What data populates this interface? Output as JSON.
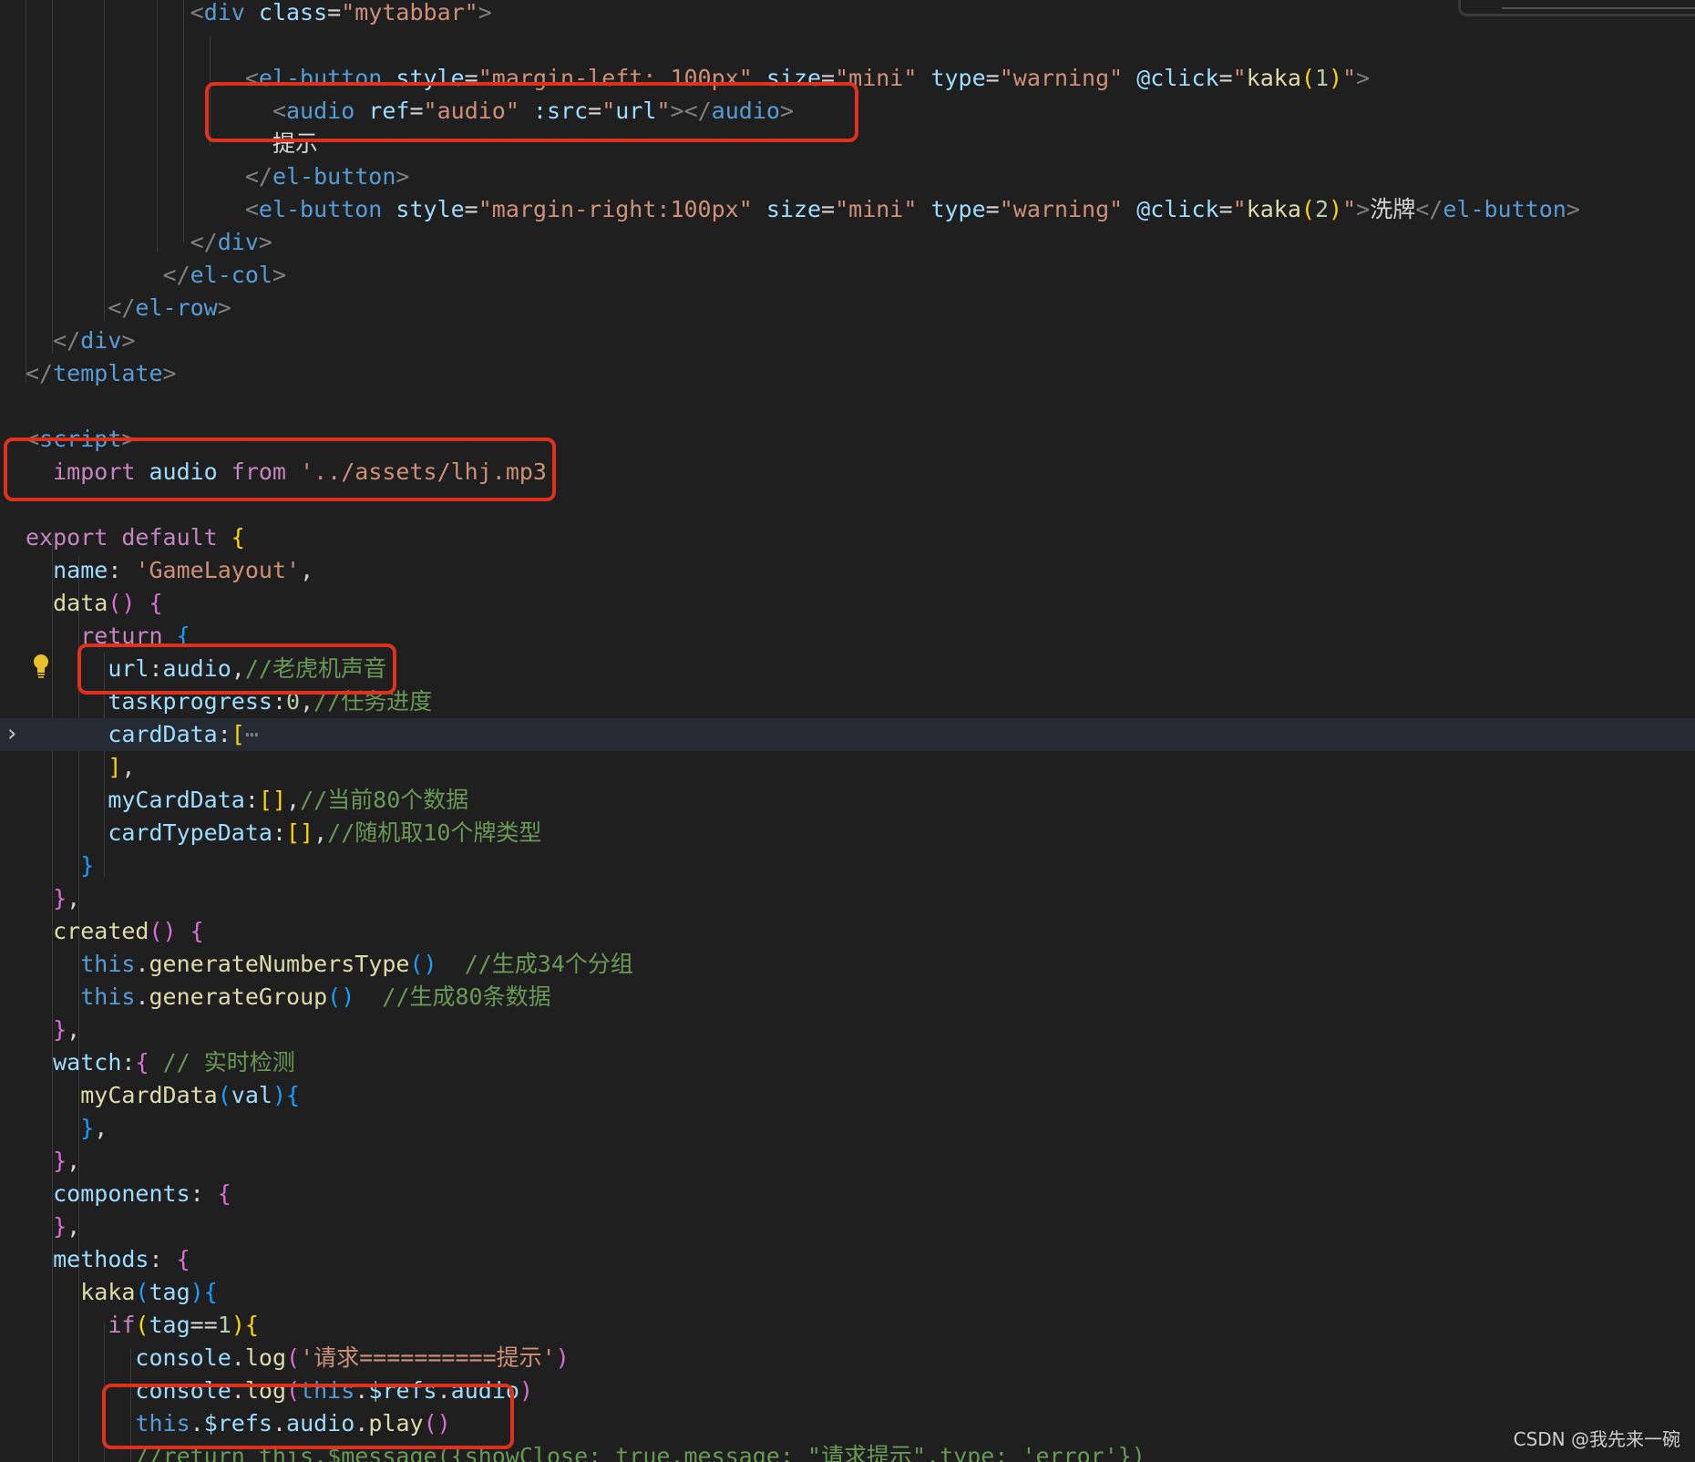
{
  "colors": {
    "background": "#1f1f1f",
    "tag": "#569cd6",
    "bracket": "#808080",
    "attr": "#9cdcfe",
    "string": "#ce9178",
    "keyword": "#c586c0",
    "thisKw": "#569cd6",
    "function": "#dcdcaa",
    "comment": "#6a9955",
    "number": "#b5cea8",
    "plain": "#d4d4d4",
    "brace1": "#ffd700",
    "brace2": "#da70d6",
    "brace3": "#179fff",
    "annotation": "#e0311d"
  },
  "icons": [
    "chevron-right-icon",
    "lightbulb-icon"
  ],
  "watermark": "CSDN @我先来一碗",
  "lines": [
    {
      "id": "l1",
      "tokens": [
        [
          "            ",
          "plain"
        ],
        [
          "<",
          "bracket"
        ],
        [
          "div",
          "tag"
        ],
        [
          " class",
          "attr"
        ],
        [
          "=",
          "plain"
        ],
        [
          "\"mytabbar\"",
          "string"
        ],
        [
          ">",
          "bracket"
        ]
      ]
    },
    {
      "id": "l2",
      "tokens": []
    },
    {
      "id": "l3",
      "tokens": [
        [
          "                ",
          "plain"
        ],
        [
          "<",
          "bracket"
        ],
        [
          "el-button",
          "tag"
        ],
        [
          " style",
          "attr"
        ],
        [
          "=",
          "plain"
        ],
        [
          "\"margin-left: 100px\"",
          "string"
        ],
        [
          " size",
          "attr"
        ],
        [
          "=",
          "plain"
        ],
        [
          "\"mini\"",
          "string"
        ],
        [
          " type",
          "attr"
        ],
        [
          "=",
          "plain"
        ],
        [
          "\"warning\"",
          "string"
        ],
        [
          " @click",
          "attr"
        ],
        [
          "=",
          "plain"
        ],
        [
          "\"",
          "string"
        ],
        [
          "kaka",
          "function"
        ],
        [
          "(",
          "brace1"
        ],
        [
          "1",
          "number"
        ],
        [
          ")",
          "brace1"
        ],
        [
          "\"",
          "string"
        ],
        [
          ">",
          "bracket"
        ]
      ]
    },
    {
      "id": "l4",
      "tokens": [
        [
          "                  ",
          "plain"
        ],
        [
          "<",
          "bracket"
        ],
        [
          "audio",
          "tag"
        ],
        [
          " ref",
          "attr"
        ],
        [
          "=",
          "plain"
        ],
        [
          "\"audio\"",
          "string"
        ],
        [
          " :src",
          "attr"
        ],
        [
          "=",
          "plain"
        ],
        [
          "\"",
          "string"
        ],
        [
          "url",
          "attr"
        ],
        [
          "\"",
          "string"
        ],
        [
          "></",
          "bracket"
        ],
        [
          "audio",
          "tag"
        ],
        [
          ">",
          "bracket"
        ]
      ]
    },
    {
      "id": "l5",
      "tokens": [
        [
          "                  ",
          "plain"
        ],
        [
          "提示",
          "plain"
        ]
      ]
    },
    {
      "id": "l6",
      "tokens": [
        [
          "                ",
          "plain"
        ],
        [
          "</",
          "bracket"
        ],
        [
          "el-button",
          "tag"
        ],
        [
          ">",
          "bracket"
        ]
      ]
    },
    {
      "id": "l7",
      "tokens": [
        [
          "                ",
          "plain"
        ],
        [
          "<",
          "bracket"
        ],
        [
          "el-button",
          "tag"
        ],
        [
          " style",
          "attr"
        ],
        [
          "=",
          "plain"
        ],
        [
          "\"margin-right:100px\"",
          "string"
        ],
        [
          " size",
          "attr"
        ],
        [
          "=",
          "plain"
        ],
        [
          "\"mini\"",
          "string"
        ],
        [
          " type",
          "attr"
        ],
        [
          "=",
          "plain"
        ],
        [
          "\"warning\"",
          "string"
        ],
        [
          " @click",
          "attr"
        ],
        [
          "=",
          "plain"
        ],
        [
          "\"",
          "string"
        ],
        [
          "kaka",
          "function"
        ],
        [
          "(",
          "brace1"
        ],
        [
          "2",
          "number"
        ],
        [
          ")",
          "brace1"
        ],
        [
          "\"",
          "string"
        ],
        [
          ">",
          "bracket"
        ],
        [
          "洗牌",
          "plain"
        ],
        [
          "</",
          "bracket"
        ],
        [
          "el-button",
          "tag"
        ],
        [
          ">",
          "bracket"
        ]
      ]
    },
    {
      "id": "l8",
      "tokens": [
        [
          "            ",
          "plain"
        ],
        [
          "</",
          "bracket"
        ],
        [
          "div",
          "tag"
        ],
        [
          ">",
          "bracket"
        ]
      ]
    },
    {
      "id": "l9",
      "tokens": [
        [
          "          ",
          "plain"
        ],
        [
          "</",
          "bracket"
        ],
        [
          "el-col",
          "tag"
        ],
        [
          ">",
          "bracket"
        ]
      ]
    },
    {
      "id": "l10",
      "tokens": [
        [
          "      ",
          "plain"
        ],
        [
          "</",
          "bracket"
        ],
        [
          "el-row",
          "tag"
        ],
        [
          ">",
          "bracket"
        ]
      ]
    },
    {
      "id": "l11",
      "tokens": [
        [
          "  ",
          "plain"
        ],
        [
          "</",
          "bracket"
        ],
        [
          "div",
          "tag"
        ],
        [
          ">",
          "bracket"
        ]
      ]
    },
    {
      "id": "l12",
      "tokens": [
        [
          "</",
          "bracket"
        ],
        [
          "template",
          "tag"
        ],
        [
          ">",
          "bracket"
        ]
      ]
    },
    {
      "id": "l13",
      "tokens": []
    },
    {
      "id": "l14",
      "tokens": [
        [
          "<",
          "bracket"
        ],
        [
          "script",
          "tag"
        ],
        [
          ">",
          "bracket"
        ]
      ]
    },
    {
      "id": "l15",
      "tokens": [
        [
          "  ",
          "plain"
        ],
        [
          "import",
          "keyword"
        ],
        [
          " audio ",
          "attr"
        ],
        [
          "from",
          "keyword"
        ],
        [
          " ",
          "plain"
        ],
        [
          "'../assets/lhj.mp3'",
          "string"
        ]
      ]
    },
    {
      "id": "l16",
      "tokens": []
    },
    {
      "id": "l17",
      "tokens": [
        [
          "export",
          "keyword"
        ],
        [
          " ",
          "plain"
        ],
        [
          "default",
          "keyword"
        ],
        [
          " ",
          "plain"
        ],
        [
          "{",
          "brace1"
        ]
      ]
    },
    {
      "id": "l18",
      "tokens": [
        [
          "  ",
          "plain"
        ],
        [
          "name",
          "attr"
        ],
        [
          ": ",
          "plain"
        ],
        [
          "'GameLayout'",
          "string"
        ],
        [
          ",",
          "plain"
        ]
      ]
    },
    {
      "id": "l19",
      "tokens": [
        [
          "  ",
          "plain"
        ],
        [
          "data",
          "function"
        ],
        [
          "()",
          "brace2"
        ],
        [
          " ",
          "plain"
        ],
        [
          "{",
          "brace2"
        ]
      ]
    },
    {
      "id": "l20",
      "tokens": [
        [
          "    ",
          "plain"
        ],
        [
          "return",
          "keyword"
        ],
        [
          " ",
          "plain"
        ],
        [
          "{",
          "brace3"
        ]
      ]
    },
    {
      "id": "l21",
      "tokens": [
        [
          "      ",
          "plain"
        ],
        [
          "url",
          "attr"
        ],
        [
          ":",
          "plain"
        ],
        [
          "audio",
          "attr"
        ],
        [
          ",",
          "plain"
        ],
        [
          "//老虎机声音",
          "comment"
        ]
      ]
    },
    {
      "id": "l22",
      "tokens": [
        [
          "      ",
          "plain"
        ],
        [
          "taskprogress",
          "attr"
        ],
        [
          ":",
          "plain"
        ],
        [
          "0",
          "number"
        ],
        [
          ",",
          "plain"
        ],
        [
          "//任务进度",
          "comment"
        ]
      ]
    },
    {
      "id": "l23",
      "tokens": [
        [
          "      ",
          "plain"
        ],
        [
          "cardData",
          "attr"
        ],
        [
          ":",
          "plain"
        ],
        [
          "[",
          "brace1"
        ],
        [
          "⋯",
          "bracket"
        ]
      ]
    },
    {
      "id": "l24",
      "tokens": [
        [
          "      ",
          "plain"
        ],
        [
          "]",
          "brace1"
        ],
        [
          ",",
          "plain"
        ]
      ]
    },
    {
      "id": "l25",
      "tokens": [
        [
          "      ",
          "plain"
        ],
        [
          "myCardData",
          "attr"
        ],
        [
          ":",
          "plain"
        ],
        [
          "[]",
          "brace1"
        ],
        [
          ",",
          "plain"
        ],
        [
          "//当前80个数据",
          "comment"
        ]
      ]
    },
    {
      "id": "l26",
      "tokens": [
        [
          "      ",
          "plain"
        ],
        [
          "cardTypeData",
          "attr"
        ],
        [
          ":",
          "plain"
        ],
        [
          "[]",
          "brace1"
        ],
        [
          ",",
          "plain"
        ],
        [
          "//随机取10个牌类型",
          "comment"
        ]
      ]
    },
    {
      "id": "l27",
      "tokens": [
        [
          "    ",
          "plain"
        ],
        [
          "}",
          "brace3"
        ]
      ]
    },
    {
      "id": "l28",
      "tokens": [
        [
          "  ",
          "plain"
        ],
        [
          "}",
          "brace2"
        ],
        [
          ",",
          "plain"
        ]
      ]
    },
    {
      "id": "l29",
      "tokens": [
        [
          "  ",
          "plain"
        ],
        [
          "created",
          "function"
        ],
        [
          "()",
          "brace2"
        ],
        [
          " ",
          "plain"
        ],
        [
          "{",
          "brace2"
        ]
      ]
    },
    {
      "id": "l30",
      "tokens": [
        [
          "    ",
          "plain"
        ],
        [
          "this",
          "thisKw"
        ],
        [
          ".",
          "plain"
        ],
        [
          "generateNumbersType",
          "function"
        ],
        [
          "()",
          "brace3"
        ],
        [
          "  ",
          "plain"
        ],
        [
          "//生成34个分组",
          "comment"
        ]
      ]
    },
    {
      "id": "l31",
      "tokens": [
        [
          "    ",
          "plain"
        ],
        [
          "this",
          "thisKw"
        ],
        [
          ".",
          "plain"
        ],
        [
          "generateGroup",
          "function"
        ],
        [
          "()",
          "brace3"
        ],
        [
          "  ",
          "plain"
        ],
        [
          "//生成80条数据",
          "comment"
        ]
      ]
    },
    {
      "id": "l32",
      "tokens": [
        [
          "  ",
          "plain"
        ],
        [
          "}",
          "brace2"
        ],
        [
          ",",
          "plain"
        ]
      ]
    },
    {
      "id": "l33",
      "tokens": [
        [
          "  ",
          "plain"
        ],
        [
          "watch",
          "attr"
        ],
        [
          ":",
          "plain"
        ],
        [
          "{",
          "brace2"
        ],
        [
          " ",
          "plain"
        ],
        [
          "// 实时检测",
          "comment"
        ]
      ]
    },
    {
      "id": "l34",
      "tokens": [
        [
          "    ",
          "plain"
        ],
        [
          "myCardData",
          "function"
        ],
        [
          "(",
          "brace3"
        ],
        [
          "val",
          "attr"
        ],
        [
          ")",
          "brace3"
        ],
        [
          "{",
          "brace3"
        ]
      ]
    },
    {
      "id": "l35",
      "tokens": [
        [
          "    ",
          "plain"
        ],
        [
          "}",
          "brace3"
        ],
        [
          ",",
          "plain"
        ]
      ]
    },
    {
      "id": "l36",
      "tokens": [
        [
          "  ",
          "plain"
        ],
        [
          "}",
          "brace2"
        ],
        [
          ",",
          "plain"
        ]
      ]
    },
    {
      "id": "l37",
      "tokens": [
        [
          "  ",
          "plain"
        ],
        [
          "components",
          "attr"
        ],
        [
          ": ",
          "plain"
        ],
        [
          "{",
          "brace2"
        ]
      ]
    },
    {
      "id": "l38",
      "tokens": [
        [
          "  ",
          "plain"
        ],
        [
          "}",
          "brace2"
        ],
        [
          ",",
          "plain"
        ]
      ]
    },
    {
      "id": "l39",
      "tokens": [
        [
          "  ",
          "plain"
        ],
        [
          "methods",
          "attr"
        ],
        [
          ": ",
          "plain"
        ],
        [
          "{",
          "brace2"
        ]
      ]
    },
    {
      "id": "l40",
      "tokens": [
        [
          "    ",
          "plain"
        ],
        [
          "kaka",
          "function"
        ],
        [
          "(",
          "brace3"
        ],
        [
          "tag",
          "attr"
        ],
        [
          ")",
          "brace3"
        ],
        [
          "{",
          "brace3"
        ]
      ]
    },
    {
      "id": "l41",
      "tokens": [
        [
          "      ",
          "plain"
        ],
        [
          "if",
          "keyword"
        ],
        [
          "(",
          "brace1"
        ],
        [
          "tag",
          "attr"
        ],
        [
          "==",
          "plain"
        ],
        [
          "1",
          "number"
        ],
        [
          ")",
          "brace1"
        ],
        [
          "{",
          "brace1"
        ]
      ]
    },
    {
      "id": "l42",
      "tokens": [
        [
          "        ",
          "plain"
        ],
        [
          "console",
          "attr"
        ],
        [
          ".",
          "plain"
        ],
        [
          "log",
          "function"
        ],
        [
          "(",
          "brace2"
        ],
        [
          "'请求==========提示'",
          "string"
        ],
        [
          ")",
          "brace2"
        ]
      ]
    },
    {
      "id": "l43",
      "tokens": [
        [
          "        ",
          "plain"
        ],
        [
          "console",
          "attr"
        ],
        [
          ".",
          "plain"
        ],
        [
          "log",
          "function"
        ],
        [
          "(",
          "brace2"
        ],
        [
          "this",
          "thisKw"
        ],
        [
          ".",
          "plain"
        ],
        [
          "$refs",
          "attr"
        ],
        [
          ".",
          "plain"
        ],
        [
          "audio",
          "attr"
        ],
        [
          ")",
          "brace2"
        ]
      ]
    },
    {
      "id": "l44",
      "tokens": [
        [
          "        ",
          "plain"
        ],
        [
          "this",
          "thisKw"
        ],
        [
          ".",
          "plain"
        ],
        [
          "$refs",
          "attr"
        ],
        [
          ".",
          "plain"
        ],
        [
          "audio",
          "attr"
        ],
        [
          ".",
          "plain"
        ],
        [
          "play",
          "function"
        ],
        [
          "()",
          "brace2"
        ]
      ]
    },
    {
      "id": "l45",
      "tokens": [
        [
          "        ",
          "plain"
        ],
        [
          "//return this.$message({showClose: true,message: \"请求提示\",type: 'error'})",
          "comment"
        ]
      ]
    }
  ]
}
